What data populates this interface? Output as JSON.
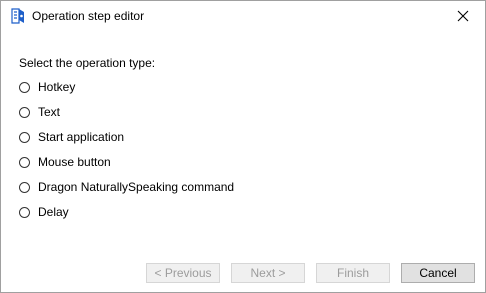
{
  "window": {
    "title": "Operation step editor"
  },
  "form": {
    "prompt": "Select the operation type:",
    "options": [
      {
        "label": "Hotkey",
        "selected": false
      },
      {
        "label": "Text",
        "selected": false
      },
      {
        "label": "Start application",
        "selected": false
      },
      {
        "label": "Mouse button",
        "selected": false
      },
      {
        "label": "Dragon NaturallySpeaking command",
        "selected": false
      },
      {
        "label": "Delay",
        "selected": false
      }
    ]
  },
  "buttons": {
    "previous": {
      "label": "< Previous",
      "enabled": false
    },
    "next": {
      "label": "Next >",
      "enabled": false
    },
    "finish": {
      "label": "Finish",
      "enabled": false
    },
    "cancel": {
      "label": "Cancel",
      "enabled": true
    }
  },
  "icons": {
    "app": "app-icon",
    "close": "close-icon"
  },
  "colors": {
    "accent_blue": "#1e5fc9",
    "border": "#a0a0a0",
    "disabled_text": "#9c9c9c"
  }
}
